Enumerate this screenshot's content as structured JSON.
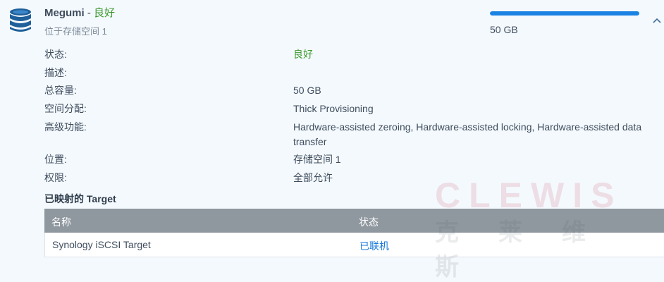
{
  "lun": {
    "name": "Megumi",
    "separator": "-",
    "status": "良好",
    "location": "位于存储空间 1",
    "capacity": "50 GB",
    "usage_fraction": 1.0,
    "accent_color": "#1a82e2",
    "status_color": "#3d9a2e",
    "icon": "database-icon",
    "collapse_icon": "chevron-up-icon"
  },
  "details": [
    {
      "label": "状态:",
      "value": "良好"
    },
    {
      "label": "描述:",
      "value": ""
    },
    {
      "label": "总容量:",
      "value": "50 GB"
    },
    {
      "label": "空间分配:",
      "value": "Thick Provisioning"
    },
    {
      "label": "高级功能:",
      "value": "Hardware-assisted zeroing, Hardware-assisted locking, Hardware-assisted data transfer"
    },
    {
      "label": "位置:",
      "value": "存储空间 1"
    },
    {
      "label": "权限:",
      "value": "全部允许"
    }
  ],
  "mapped_targets": {
    "title": "已映射的 Target",
    "columns": [
      "名称",
      "状态"
    ],
    "rows": [
      {
        "name": "Synology iSCSI Target",
        "status": "已联机"
      }
    ]
  },
  "watermark": {
    "en": "CLEWIS",
    "cn": "克莱维斯"
  }
}
